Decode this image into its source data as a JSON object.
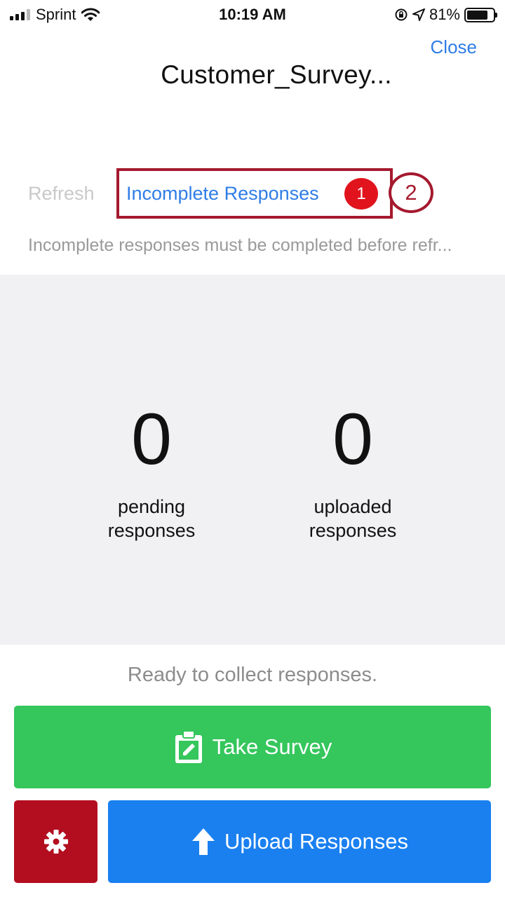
{
  "status_bar": {
    "carrier": "Sprint",
    "time": "10:19 AM",
    "battery_percent": "81%",
    "battery_level": 0.81,
    "icons": [
      "signal-bars-icon",
      "wifi-icon",
      "orientation-lock-icon",
      "location-arrow-icon",
      "battery-icon"
    ]
  },
  "header": {
    "close_label": "Close",
    "title": "Customer_Survey..."
  },
  "actions": {
    "refresh_label": "Refresh",
    "incomplete_label": "Incomplete Responses",
    "incomplete_count": "1",
    "step_callout": "2",
    "warning": "Incomplete responses must be completed before refr..."
  },
  "stats": {
    "pending_value": "0",
    "pending_label_line1": "pending",
    "pending_label_line2": "responses",
    "uploaded_value": "0",
    "uploaded_label_line1": "uploaded",
    "uploaded_label_line2": "responses"
  },
  "footer": {
    "ready_text": "Ready to collect responses.",
    "take_survey_label": "Take Survey",
    "take_survey_icon": "clipboard-edit-icon",
    "settings_icon": "gear-icon",
    "upload_label": "Upload Responses",
    "upload_icon": "upload-arrow-icon"
  },
  "colors": {
    "link_blue": "#2f7de6",
    "badge_red": "#e1141d",
    "callout_maroon": "#a5192e",
    "take_survey_green": "#35c65c",
    "settings_red": "#b30e20",
    "upload_blue": "#1a80f0",
    "panel_gray": "#f1f1f4"
  }
}
